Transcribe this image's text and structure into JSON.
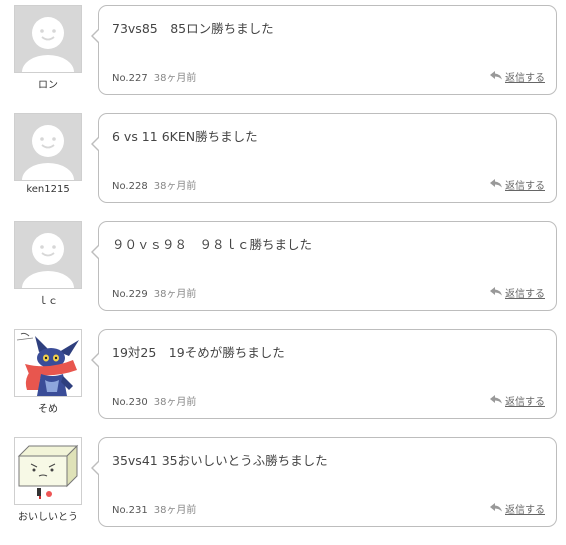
{
  "reply_label": "返信する",
  "comments": [
    {
      "user": "ロン",
      "avatar": "default-avatar",
      "text": "73vs85　85ロン勝ちました",
      "no": "No.227",
      "ago": "38ヶ月前"
    },
    {
      "user": "ken1215",
      "avatar": "default-avatar",
      "text": "6 vs 11 6KEN勝ちました",
      "no": "No.228",
      "ago": "38ヶ月前"
    },
    {
      "user": "ｌｃ",
      "avatar": "default-avatar",
      "text": "９０ｖｓ９８　９８ｌｃ勝ちました",
      "no": "No.229",
      "ago": "38ヶ月前"
    },
    {
      "user": "そめ",
      "avatar": "character-avatar",
      "text": "19対25　19そめが勝ちました",
      "no": "No.230",
      "ago": "38ヶ月前"
    },
    {
      "user": "おいしいとう",
      "avatar": "tofu-avatar",
      "text": "35vs41 35おいしいとうふ勝ちました",
      "no": "No.231",
      "ago": "38ヶ月前"
    }
  ]
}
